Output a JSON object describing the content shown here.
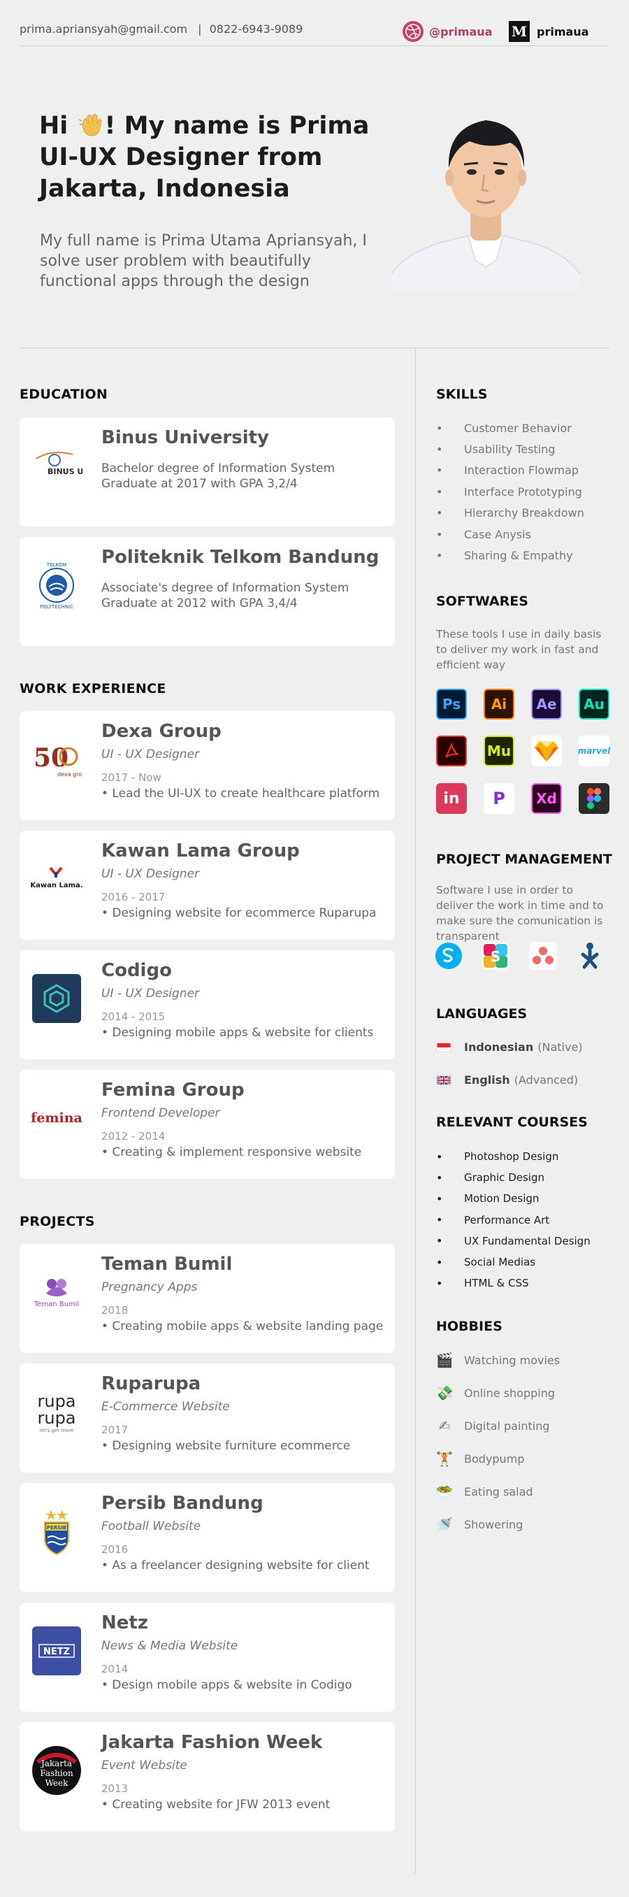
{
  "contact": {
    "email": "prima.apriansyah@gmail.com",
    "separator": "|",
    "phone": "0822-6943-9089",
    "dribbble": "@primaua",
    "medium_letter": "M",
    "medium": "primaua"
  },
  "hero": {
    "greeting": "Hi",
    "title_rest": "!  My name is Prima",
    "title_line2": "UI-UX Designer from",
    "title_line3": "Jakarta, Indonesia",
    "desc": "My full name is Prima Utama Apriansyah, I solve user problem with beautifully functional apps through the design"
  },
  "education": {
    "title": "EDUCATION",
    "items": [
      {
        "name": "Binus University",
        "desc": "Bachelor degree of Information System Graduate at 2017 with GPA 3,2/4",
        "logo_text": "BINUS UNIVERSITY"
      },
      {
        "name": "Politeknik Telkom Bandung",
        "desc": "Associate's degree of Information System Graduate at 2012 with GPA 3,4/4",
        "logo_text": "TELKOM POLYTECHNIC"
      }
    ]
  },
  "work": {
    "title": "WORK EXPERIENCE",
    "items": [
      {
        "name": "Dexa Group",
        "role": "UI - UX Designer",
        "date": "2017 - Now",
        "desc": "• Lead the UI-UX to create healthcare platform",
        "logo_text": "50",
        "logo_sub": "dexa group"
      },
      {
        "name": "Kawan Lama Group",
        "role": "UI - UX Designer",
        "date": "2016 - 2017",
        "desc": "• Designing website for ecommerce Ruparupa",
        "logo_text": "Kawan Lama."
      },
      {
        "name": "Codigo",
        "role": "UI - UX Designer",
        "date": "2014 - 2015",
        "desc": "• Designing mobile apps & website for clients"
      },
      {
        "name": "Femina Group",
        "role": "Frontend Developer",
        "date": "2012 - 2014",
        "desc": "• Creating & implement responsive website",
        "logo_text": "femina"
      }
    ]
  },
  "projects": {
    "title": "PROJECTS",
    "items": [
      {
        "name": "Teman Bumil",
        "role": "Pregnancy Apps",
        "date": "2018",
        "desc": "• Creating mobile apps & website landing page",
        "logo_text": "Teman Bumil"
      },
      {
        "name": "Ruparupa",
        "role": "E-Commerce Website",
        "date": "2017",
        "desc": "• Designing website furniture ecommerce",
        "logo_text": "rupa",
        "logo_sub": "let's get more"
      },
      {
        "name": "Persib Bandung",
        "role": "Football Website",
        "date": "2016",
        "desc": "• As a freelancer designing website for client",
        "logo_text": "PERSIB"
      },
      {
        "name": "Netz",
        "role": "News & Media Website",
        "date": "2014",
        "desc": "• Design mobile apps & website in Codigo",
        "logo_text": "NETZ"
      },
      {
        "name": "Jakarta Fashion Week",
        "role": "Event Website",
        "date": "2013",
        "desc": "• Creating website for JFW 2013 event",
        "logo_text": "Jakarta Fashion Week"
      }
    ]
  },
  "skills": {
    "title": "SKILLS",
    "items": [
      "Customer Behavior",
      "Usability Testing",
      "Interaction Flowmap",
      "Interface Prototyping",
      "Hierarchy Breakdown",
      "Case Anysis",
      "Sharing & Empathy"
    ]
  },
  "softwares": {
    "title": "SOFTWARES",
    "desc": "These tools I use in daily basis to deliver my work in fast and efficient way",
    "tools": [
      {
        "label": "Ps",
        "icon": "photoshop-icon"
      },
      {
        "label": "Ai",
        "icon": "illustrator-icon"
      },
      {
        "label": "Ae",
        "icon": "after-effects-icon"
      },
      {
        "label": "Au",
        "icon": "audition-icon"
      },
      {
        "label": "",
        "icon": "acrobat-icon"
      },
      {
        "label": "Mu",
        "icon": "muse-icon"
      },
      {
        "label": "",
        "icon": "sketch-icon"
      },
      {
        "label": "marvel",
        "icon": "marvel-icon"
      },
      {
        "label": "in",
        "icon": "invision-icon"
      },
      {
        "label": "P",
        "icon": "principle-icon"
      },
      {
        "label": "Xd",
        "icon": "xd-icon"
      },
      {
        "label": "",
        "icon": "figma-icon"
      }
    ]
  },
  "project_management": {
    "title": "PROJECT MANAGEMENT",
    "desc": "Software I use in order to deliver the work in time and to make sure the comunication is transparent",
    "tools": [
      "skype-icon",
      "slack-icon",
      "asana-icon",
      "jira-icon"
    ]
  },
  "languages": {
    "title": "LANGUAGES",
    "items": [
      {
        "name": "Indonesian",
        "level": "(Native)",
        "flag": "indonesia-flag-icon"
      },
      {
        "name": "English",
        "level": "(Advanced)",
        "flag": "uk-flag-icon"
      }
    ]
  },
  "courses": {
    "title": "RELEVANT COURSES",
    "items": [
      "Photoshop Design",
      "Graphic Design",
      "Motion Design",
      "Performance Art",
      "UX Fundamental Design",
      "Social Medias",
      "HTML & CSS"
    ]
  },
  "hobbies": {
    "title": "HOBBIES",
    "items": [
      {
        "label": "Watching movies",
        "icon": "clapperboard-icon",
        "glyph": "🎬"
      },
      {
        "label": "Online shopping",
        "icon": "money-icon",
        "glyph": "💸"
      },
      {
        "label": "Digital painting",
        "icon": "writing-hand-icon",
        "glyph": "✍"
      },
      {
        "label": "Bodypump",
        "icon": "weightlifter-icon",
        "glyph": "🏋"
      },
      {
        "label": "Eating salad",
        "icon": "salad-icon",
        "glyph": "🥗"
      },
      {
        "label": "Showering",
        "icon": "shower-icon",
        "glyph": "🚿"
      }
    ]
  }
}
